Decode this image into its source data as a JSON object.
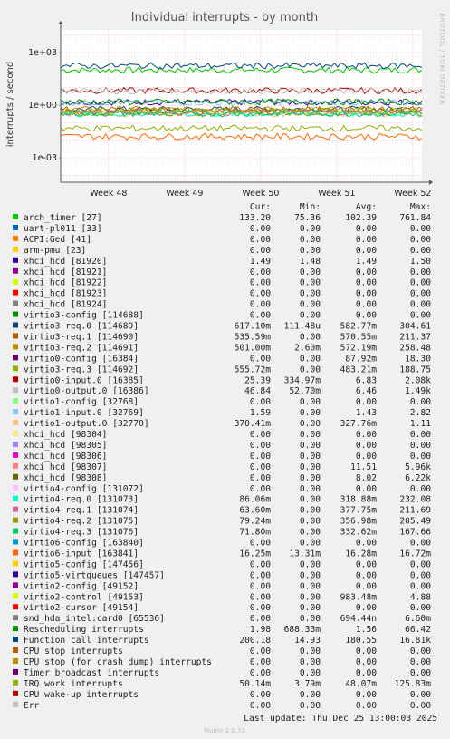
{
  "chart_data": {
    "type": "line",
    "title": "Individual interrupts - by month",
    "ylabel": "interrupts / second",
    "yscale": "log",
    "ylim": [
      4e-05,
      20000
    ],
    "yticks": [
      "1e+03",
      "1e+00",
      "1e-03"
    ],
    "xticks": [
      "Week 48",
      "Week 49",
      "Week 50",
      "Week 51",
      "Week 52"
    ],
    "side_label": "RRDTOOL / TOBI OETIKER",
    "columns": [
      "Cur:",
      "Min:",
      "Avg:",
      "Max:"
    ],
    "series": [
      {
        "name": "arch_timer [27]",
        "color": "#00cc00",
        "cur": "133.20",
        "min": "75.36",
        "avg": "102.39",
        "max": "761.84",
        "level": 102
      },
      {
        "name": "uart-pl011 [33]",
        "color": "#0066b3",
        "cur": "0.00",
        "min": "0.00",
        "avg": "0.00",
        "max": "0.00"
      },
      {
        "name": "ACPI:Ged [41]",
        "color": "#ff8000",
        "cur": "0.00",
        "min": "0.00",
        "avg": "0.00",
        "max": "0.00"
      },
      {
        "name": "arm-pmu [23]",
        "color": "#ffcc00",
        "cur": "0.00",
        "min": "0.00",
        "avg": "0.00",
        "max": "0.00"
      },
      {
        "name": "xhci_hcd [81920]",
        "color": "#330099",
        "cur": "1.49",
        "min": "1.48",
        "avg": "1.49",
        "max": "1.50",
        "level": 1.49
      },
      {
        "name": "xhci_hcd [81921]",
        "color": "#990099",
        "cur": "0.00",
        "min": "0.00",
        "avg": "0.00",
        "max": "0.00"
      },
      {
        "name": "xhci_hcd [81922]",
        "color": "#ccff00",
        "cur": "0.00",
        "min": "0.00",
        "avg": "0.00",
        "max": "0.00"
      },
      {
        "name": "xhci_hcd [81923]",
        "color": "#ff0000",
        "cur": "0.00",
        "min": "0.00",
        "avg": "0.00",
        "max": "0.00"
      },
      {
        "name": "xhci_hcd [81924]",
        "color": "#808080",
        "cur": "0.00",
        "min": "0.00",
        "avg": "0.00",
        "max": "0.00"
      },
      {
        "name": "virtio3-config [114688]",
        "color": "#008f00",
        "cur": "0.00",
        "min": "0.00",
        "avg": "0.00",
        "max": "0.00"
      },
      {
        "name": "virtio3-req.0 [114689]",
        "color": "#00487d",
        "cur": "617.10m",
        "min": "111.48u",
        "avg": "582.77m",
        "max": "304.61",
        "level": 0.58
      },
      {
        "name": "virtio3-req.1 [114690]",
        "color": "#b35a00",
        "cur": "535.59m",
        "min": "0.00",
        "avg": "570.55m",
        "max": "211.37",
        "level": 0.57
      },
      {
        "name": "virtio3-req.2 [114691]",
        "color": "#b38f00",
        "cur": "501.00m",
        "min": "2.60m",
        "avg": "572.19m",
        "max": "258.48",
        "level": 0.57
      },
      {
        "name": "virtio0-config [16384]",
        "color": "#6b006b",
        "cur": "0.00",
        "min": "0.00",
        "avg": "87.92m",
        "max": "18.30"
      },
      {
        "name": "virtio3-req.3 [114692]",
        "color": "#8fb300",
        "cur": "555.72m",
        "min": "0.00",
        "avg": "483.21m",
        "max": "188.75",
        "level": 0.48
      },
      {
        "name": "virtio0-input.0 [16385]",
        "color": "#b30000",
        "cur": "25.39",
        "min": "334.97m",
        "avg": "6.83",
        "max": "2.08k",
        "level": 6.83
      },
      {
        "name": "virtio0-output.0 [16386]",
        "color": "#bebebe",
        "cur": "46.84",
        "min": "52.70m",
        "avg": "6.46",
        "max": "1.49k",
        "level": 6.46
      },
      {
        "name": "virtio1-config [32768]",
        "color": "#80ff80",
        "cur": "0.00",
        "min": "0.00",
        "avg": "0.00",
        "max": "0.00"
      },
      {
        "name": "virtio1-input.0 [32769]",
        "color": "#80c9ff",
        "cur": "1.59",
        "min": "0.00",
        "avg": "1.43",
        "max": "2.82",
        "level": 1.43
      },
      {
        "name": "virtio1-output.0 [32770]",
        "color": "#ffc080",
        "cur": "370.41m",
        "min": "0.00",
        "avg": "327.76m",
        "max": "1.11",
        "level": 0.33
      },
      {
        "name": "xhci_hcd [98304]",
        "color": "#ffe680",
        "cur": "0.00",
        "min": "0.00",
        "avg": "0.00",
        "max": "0.00"
      },
      {
        "name": "xhci_hcd [98305]",
        "color": "#aa80ff",
        "cur": "0.00",
        "min": "0.00",
        "avg": "0.00",
        "max": "0.00"
      },
      {
        "name": "xhci_hcd [98306]",
        "color": "#ee00cc",
        "cur": "0.00",
        "min": "0.00",
        "avg": "0.00",
        "max": "0.00"
      },
      {
        "name": "xhci_hcd [98307]",
        "color": "#ff8080",
        "cur": "0.00",
        "min": "0.00",
        "avg": "11.51",
        "max": "5.96k"
      },
      {
        "name": "xhci_hcd [98308]",
        "color": "#666600",
        "cur": "0.00",
        "min": "0.00",
        "avg": "8.02",
        "max": "6.22k"
      },
      {
        "name": "virtio4-config [131072]",
        "color": "#ffbfff",
        "cur": "0.00",
        "min": "0.00",
        "avg": "0.00",
        "max": "0.00"
      },
      {
        "name": "virtio4-req.0 [131073]",
        "color": "#00ffcc",
        "cur": "86.06m",
        "min": "0.00",
        "avg": "318.88m",
        "max": "232.08",
        "level": 0.32
      },
      {
        "name": "virtio4-req.1 [131074]",
        "color": "#cc6699",
        "cur": "63.60m",
        "min": "0.00",
        "avg": "377.75m",
        "max": "211.69",
        "level": 0.38
      },
      {
        "name": "virtio4-req.2 [131075]",
        "color": "#999900",
        "cur": "79.24m",
        "min": "0.00",
        "avg": "356.98m",
        "max": "205.49",
        "level": 0.36
      },
      {
        "name": "virtio4-req.3 [131076]",
        "color": "#00cc66",
        "cur": "71.80m",
        "min": "0.00",
        "avg": "332.62m",
        "max": "167.66",
        "level": 0.33
      },
      {
        "name": "virtio6-config [163840]",
        "color": "#0099cc",
        "cur": "0.00",
        "min": "0.00",
        "avg": "0.00",
        "max": "0.00"
      },
      {
        "name": "virtio6-input [163841]",
        "color": "#ff6600",
        "cur": "16.25m",
        "min": "13.31m",
        "avg": "16.28m",
        "max": "16.72m",
        "level": 0.0163
      },
      {
        "name": "virtio5-config [147456]",
        "color": "#ffcc00",
        "cur": "0.00",
        "min": "0.00",
        "avg": "0.00",
        "max": "0.00"
      },
      {
        "name": "virtio5-virtqueues [147457]",
        "color": "#330099",
        "cur": "0.00",
        "min": "0.00",
        "avg": "0.00",
        "max": "0.00"
      },
      {
        "name": "virtio2-config [49152]",
        "color": "#990099",
        "cur": "0.00",
        "min": "0.00",
        "avg": "0.00",
        "max": "0.00"
      },
      {
        "name": "virtio2-control [49153]",
        "color": "#ccff00",
        "cur": "0.00",
        "min": "0.00",
        "avg": "983.48m",
        "max": "4.88"
      },
      {
        "name": "virtio2-cursor [49154]",
        "color": "#ff0000",
        "cur": "0.00",
        "min": "0.00",
        "avg": "0.00",
        "max": "0.00"
      },
      {
        "name": "snd_hda_intel:card0 [65536]",
        "color": "#808080",
        "cur": "0.00",
        "min": "0.00",
        "avg": "694.44n",
        "max": "6.60m"
      },
      {
        "name": "Rescheduling interrupts",
        "color": "#008f00",
        "cur": "1.98",
        "min": "688.33m",
        "avg": "1.56",
        "max": "66.42",
        "level": 1.56
      },
      {
        "name": "Function call interrupts",
        "color": "#00487d",
        "cur": "200.18",
        "min": "14.93",
        "avg": "180.55",
        "max": "16.81k",
        "level": 180
      },
      {
        "name": "CPU stop interrupts",
        "color": "#b35a00",
        "cur": "0.00",
        "min": "0.00",
        "avg": "0.00",
        "max": "0.00"
      },
      {
        "name": "CPU stop (for crash dump) interrupts",
        "color": "#b38f00",
        "cur": "0.00",
        "min": "0.00",
        "avg": "0.00",
        "max": "0.00"
      },
      {
        "name": "Timer broadcast interrupts",
        "color": "#6b006b",
        "cur": "0.00",
        "min": "0.00",
        "avg": "0.00",
        "max": "0.00"
      },
      {
        "name": "IRQ work interrupts",
        "color": "#8fb300",
        "cur": "50.14m",
        "min": "3.79m",
        "avg": "48.07m",
        "max": "125.83m",
        "level": 0.048
      },
      {
        "name": "CPU wake-up interrupts",
        "color": "#b30000",
        "cur": "0.00",
        "min": "0.00",
        "avg": "0.00",
        "max": "0.00"
      },
      {
        "name": "Err",
        "color": "#bebebe",
        "cur": "0.00",
        "min": "0.00",
        "avg": "0.00",
        "max": "0.00"
      }
    ],
    "last_update": "Last update: Thu Dec 25 13:00:03 2025",
    "footer": "Munin 2.0.73"
  }
}
